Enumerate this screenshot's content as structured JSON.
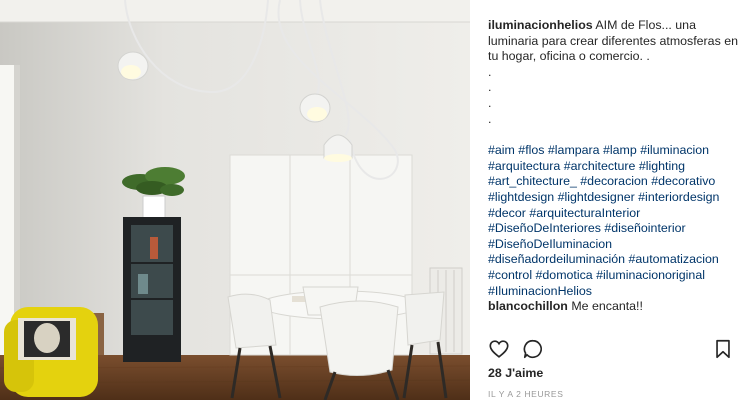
{
  "post": {
    "username": "iluminacionhelios",
    "caption": "AIM de Flos... una luminaria para crear diferentes atmosferas en tu hogar, oficina o comercio. .",
    "dots": [
      ".",
      ".",
      ".",
      "."
    ],
    "hashtags": "#aim #flos #lampara #lamp #iluminacion #arquitectura #architecture #lighting #art_chitecture_ #decoracion #decorativo #lightdesign #lightdesigner #interiordesign #decor #arquitecturaInterior #DiseñoDeInteriores #diseñointerior #DiseñoDeIluminacion #diseñadordeiluminación #automatizacion #control #domotica #iluminacionoriginal #IluminacionHelios",
    "comment": {
      "user": "blancochillon",
      "text": "Me encanta!!"
    },
    "likes": "28 J'aime",
    "time": "IL Y A 2 HEURES"
  },
  "icons": [
    "heart-icon",
    "comment-icon",
    "bookmark-icon"
  ]
}
